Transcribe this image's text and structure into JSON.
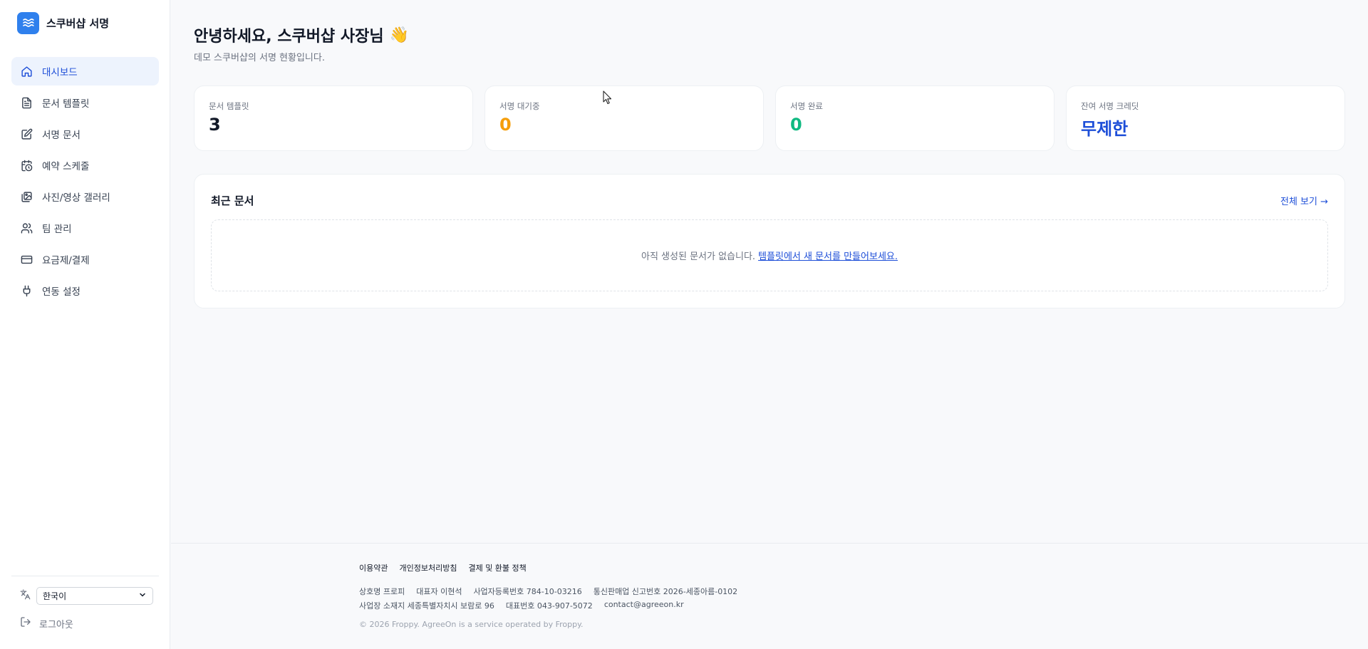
{
  "brand": {
    "name": "스쿠버샵 서명",
    "logo_icon": "waves-icon",
    "color": "#2f80ed"
  },
  "nav": [
    {
      "label": "대시보드",
      "icon": "home-icon",
      "active": true
    },
    {
      "label": "문서 템플릿",
      "icon": "file-text-icon"
    },
    {
      "label": "서명 문서",
      "icon": "pen-square-icon"
    },
    {
      "label": "예약 스케줄",
      "icon": "calendar-clock-icon"
    },
    {
      "label": "사진/영상 갤러리",
      "icon": "gallery-icon"
    },
    {
      "label": "팀 관리",
      "icon": "users-icon"
    },
    {
      "label": "요금제/결제",
      "icon": "credit-card-icon"
    },
    {
      "label": "연동 설정",
      "icon": "plug-icon"
    }
  ],
  "language": {
    "selected": "한국이",
    "icon": "translate-icon"
  },
  "logout": {
    "label": "로그아웃",
    "icon": "logout-icon"
  },
  "header": {
    "greeting": "안녕하세요, 스쿠버샵 사장님",
    "emoji": "👋",
    "subtitle": "데모 스쿠버샵의 서명 현황입니다."
  },
  "stats": [
    {
      "label": "문서 템플릿",
      "value": "3",
      "color": "#111827"
    },
    {
      "label": "서명 대기중",
      "value": "0",
      "color": "#f59e0b"
    },
    {
      "label": "서명 완료",
      "value": "0",
      "color": "#10b981"
    },
    {
      "label": "잔여 서명 크레딧",
      "value": "무제한",
      "color": "#1d4ed8"
    }
  ],
  "recent": {
    "title": "최근 문서",
    "view_all": "전체 보기 →",
    "empty_text": "아직 생성된 문서가 없습니다.",
    "empty_link": "템플릿에서 새 문서를 만들어보세요."
  },
  "footer": {
    "links": [
      "이용약관",
      "개인정보처리방침",
      "결제 및 환불 정책"
    ],
    "line1": [
      "상호명 프로피",
      "대표자 이현석",
      "사업자등록번호 784-10-03216",
      "통신판매업 신고번호 2026-세종아름-0102"
    ],
    "line2": [
      "사업장 소재지 세종특별자치시 보람로 96",
      "대표번호 043-907-5072",
      "contact@agreeon.kr"
    ],
    "copyright": "© 2026 Froppy. AgreeOn is a service operated by Froppy."
  }
}
